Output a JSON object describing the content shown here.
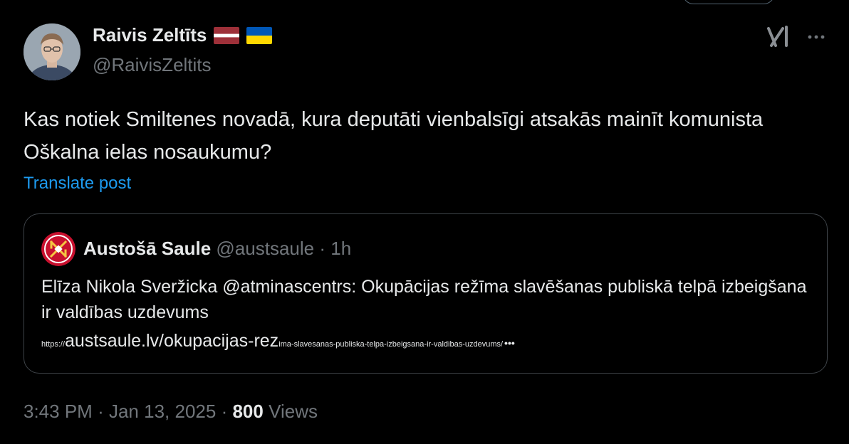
{
  "author": {
    "name": "Raivis Zeltīts",
    "handle": "@RaivisZeltits",
    "flags": [
      "latvia-flag",
      "ukraine-flag"
    ]
  },
  "tweet": {
    "text": "Kas notiek Smiltenes novadā, kura deputāti vienbalsīgi atsakās mainīt komunista Oškalna ielas nosaukumu?",
    "translate_label": "Translate post"
  },
  "quote": {
    "name": "Austošā Saule",
    "handle": "@austsaule",
    "separator": "·",
    "time": "1h",
    "text": "Elīza Nikola Sveržicka @atminascentrs: Okupācijas režīma slavēšanas publiskā telpā izbeigšana ir valdības uzdevums",
    "url_prefix": "https://",
    "url_main": "austsaule.lv/okupacijas-rez",
    "url_suffix": "ima-slavesanas-publiska-telpa-izbeigsana-ir-valdibas-uzdevums/",
    "url_ellipsis": "•••"
  },
  "meta": {
    "time": "3:43 PM",
    "sep1": "·",
    "date": "Jan 13, 2025",
    "sep2": "·",
    "views_count": "800",
    "views_label": "Views"
  },
  "icons": {
    "grok": "grok-icon",
    "more": "more-icon"
  },
  "colors": {
    "background": "#000000",
    "text_primary": "#e7e9ea",
    "text_secondary": "#71767b",
    "link": "#1d9bf0",
    "border": "#3e4348"
  }
}
